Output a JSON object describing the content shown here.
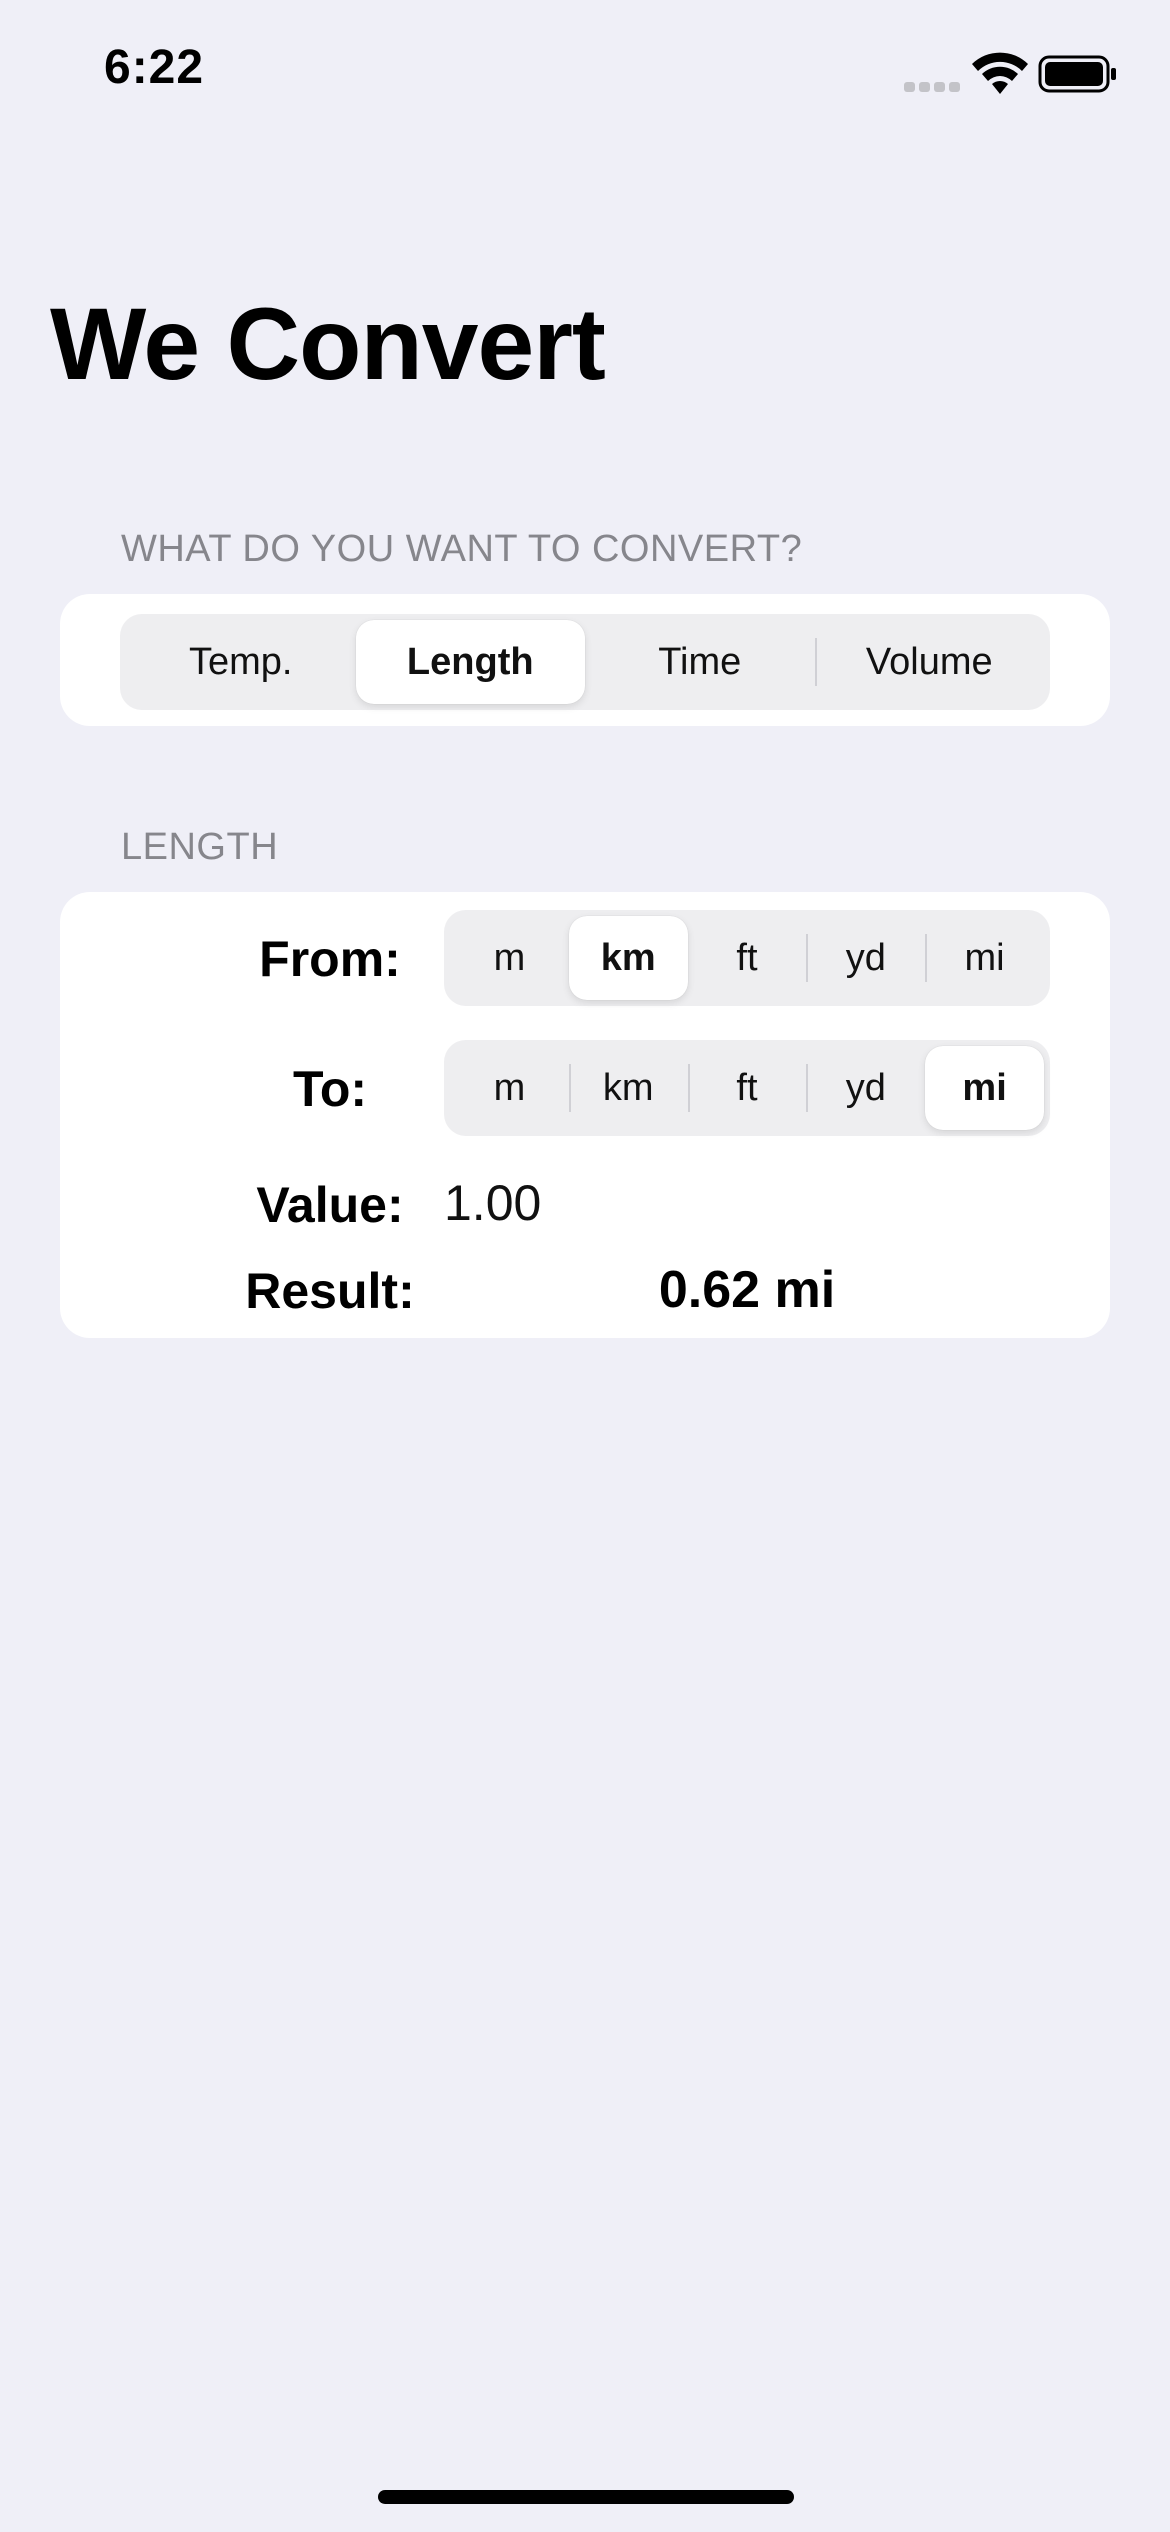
{
  "status_bar": {
    "time": "6:22",
    "icons": [
      "cellular-signal-icon",
      "wifi-icon",
      "battery-icon"
    ]
  },
  "title": "We Convert",
  "category_section": {
    "header": "WHAT DO YOU WANT TO CONVERT?",
    "options": [
      "Temp.",
      "Length",
      "Time",
      "Volume"
    ],
    "selected": "Length"
  },
  "length_section": {
    "header": "LENGTH",
    "from": {
      "label": "From:",
      "units": [
        "m",
        "km",
        "ft",
        "yd",
        "mi"
      ],
      "selected": "km"
    },
    "to": {
      "label": "To:",
      "units": [
        "m",
        "km",
        "ft",
        "yd",
        "mi"
      ],
      "selected": "mi"
    },
    "value": {
      "label": "Value:",
      "text": "1.00"
    },
    "result": {
      "label": "Result:",
      "text": "0.62 mi"
    }
  },
  "colors": {
    "background": "#efeff7",
    "card": "#ffffff",
    "segment_track": "#eeeef0",
    "section_header": "#86868c"
  }
}
